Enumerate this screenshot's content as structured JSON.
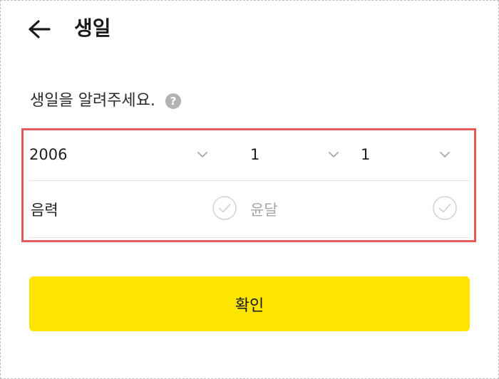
{
  "header": {
    "back_icon": "arrow-left-icon",
    "title": "생일"
  },
  "prompt": {
    "text": "생일을 알려주세요.",
    "help_icon": "question-circle-icon",
    "help_glyph": "?"
  },
  "birthday": {
    "year": "2006",
    "month": "1",
    "day": "1",
    "dropdown_icon": "chevron-down-icon"
  },
  "options": {
    "lunar_label": "음력",
    "lunar_checked": false,
    "leap_label": "윤달",
    "leap_checked": false,
    "check_icon": "check-circle-icon"
  },
  "confirm_label": "확인",
  "colors": {
    "accent": "#fee500",
    "highlight_border": "#e45a5a",
    "muted": "#b3b3b3"
  }
}
